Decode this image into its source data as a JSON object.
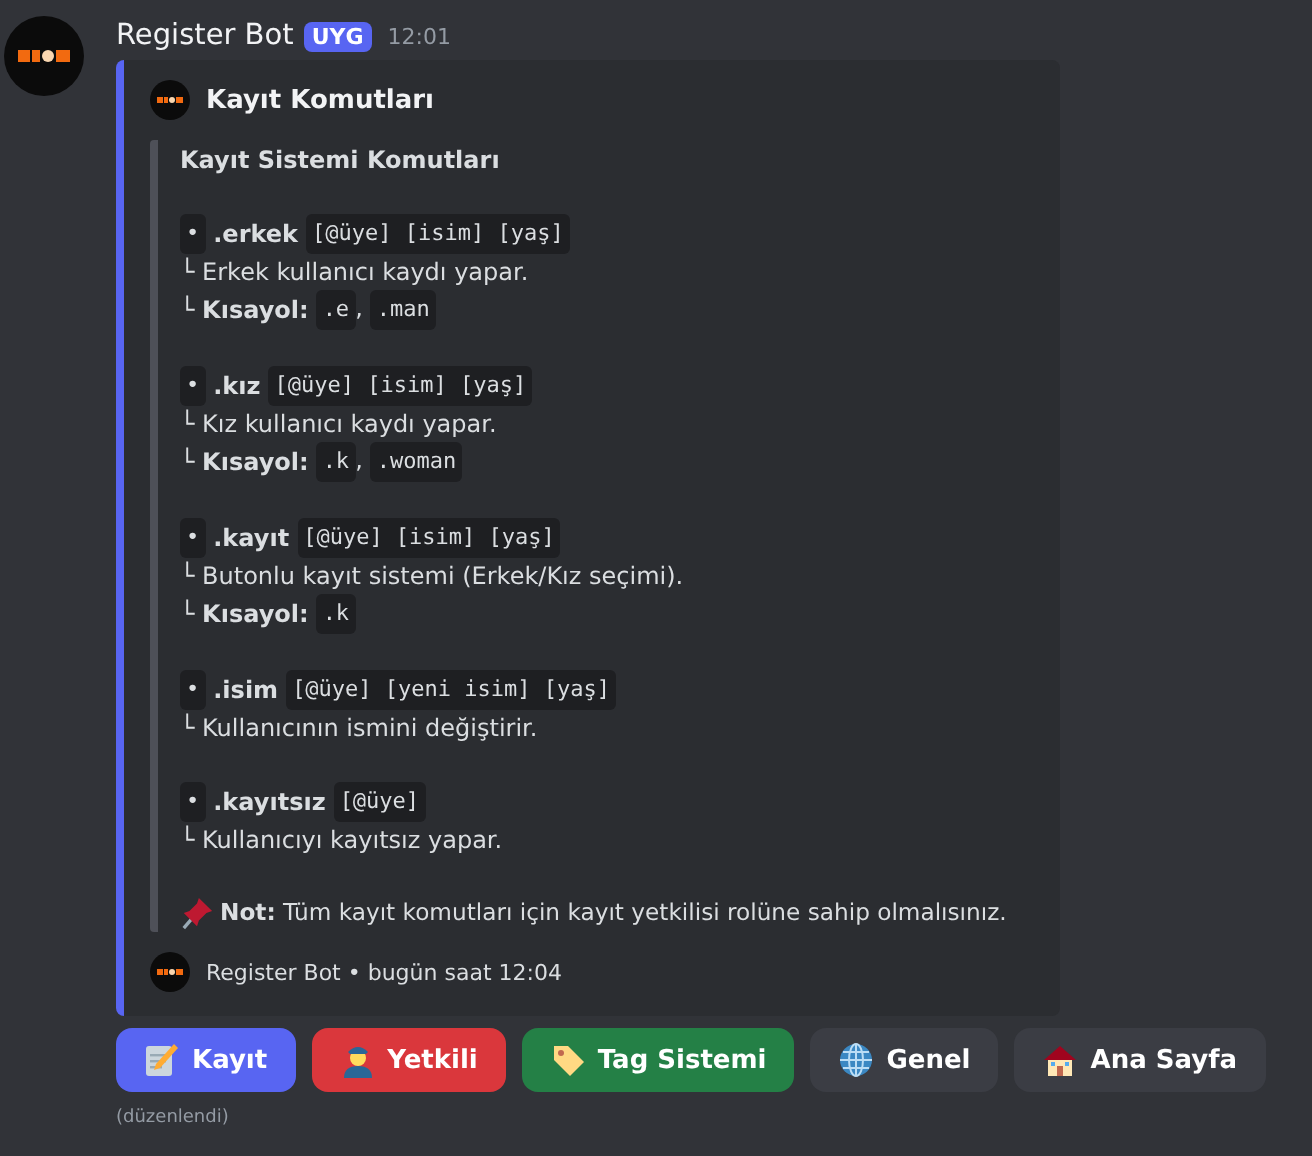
{
  "message": {
    "author": "Register Bot",
    "badge": "UYG",
    "time": "12:01",
    "edited": "(düzenlendi)"
  },
  "embed": {
    "author": "Kayıt Komutları",
    "heading": "Kayıt Sistemi Komutları",
    "commands": [
      {
        "bullet": "•",
        "name": ".erkek",
        "args": "[@üye] [isim] [yaş]",
        "lines": [
          {
            "kind": "text",
            "text": "└ Erkek kullanıcı kaydı yapar."
          },
          {
            "kind": "shortcut",
            "text": "└ **Kısayol:**",
            "codes": [
              ".e",
              ".man"
            ],
            "separator": ","
          }
        ]
      },
      {
        "bullet": "•",
        "name": ".kız",
        "args": "[@üye] [isim] [yaş]",
        "lines": [
          {
            "kind": "text",
            "text": "└ Kız kullanıcı kaydı yapar."
          },
          {
            "kind": "shortcut",
            "text": "└ **Kısayol:**",
            "codes": [
              ".k",
              ".woman"
            ],
            "separator": ","
          }
        ]
      },
      {
        "bullet": "•",
        "name": ".kayıt",
        "args": "[@üye] [isim] [yaş]",
        "lines": [
          {
            "kind": "text",
            "text": "└ Butonlu kayıt sistemi (Erkek/Kız seçimi)."
          },
          {
            "kind": "shortcut",
            "text": "└ **Kısayol:**",
            "codes": [
              ".k"
            ]
          }
        ]
      },
      {
        "bullet": "•",
        "name": ".isim",
        "args": "[@üye] [yeni isim] [yaş]",
        "lines": [
          {
            "kind": "text",
            "text": "└ Kullanıcının ismini değiştirir."
          }
        ]
      },
      {
        "bullet": "•",
        "name": ".kayıtsız",
        "args": "[@üye]",
        "lines": [
          {
            "kind": "text",
            "text": "└ Kullanıcıyı kayıtsız yapar."
          }
        ]
      }
    ],
    "note": "**Not:** Tüm kayıt komutları için kayıt yetkilisi rolüne sahip olmalısınız.",
    "footer": "Register Bot • bugün saat 12:04"
  },
  "buttons": [
    {
      "label": "Kayıt"
    },
    {
      "label": "Yetkili"
    },
    {
      "label": "Tag Sistemi"
    },
    {
      "label": "Genel"
    },
    {
      "label": "Ana Sayfa"
    }
  ]
}
